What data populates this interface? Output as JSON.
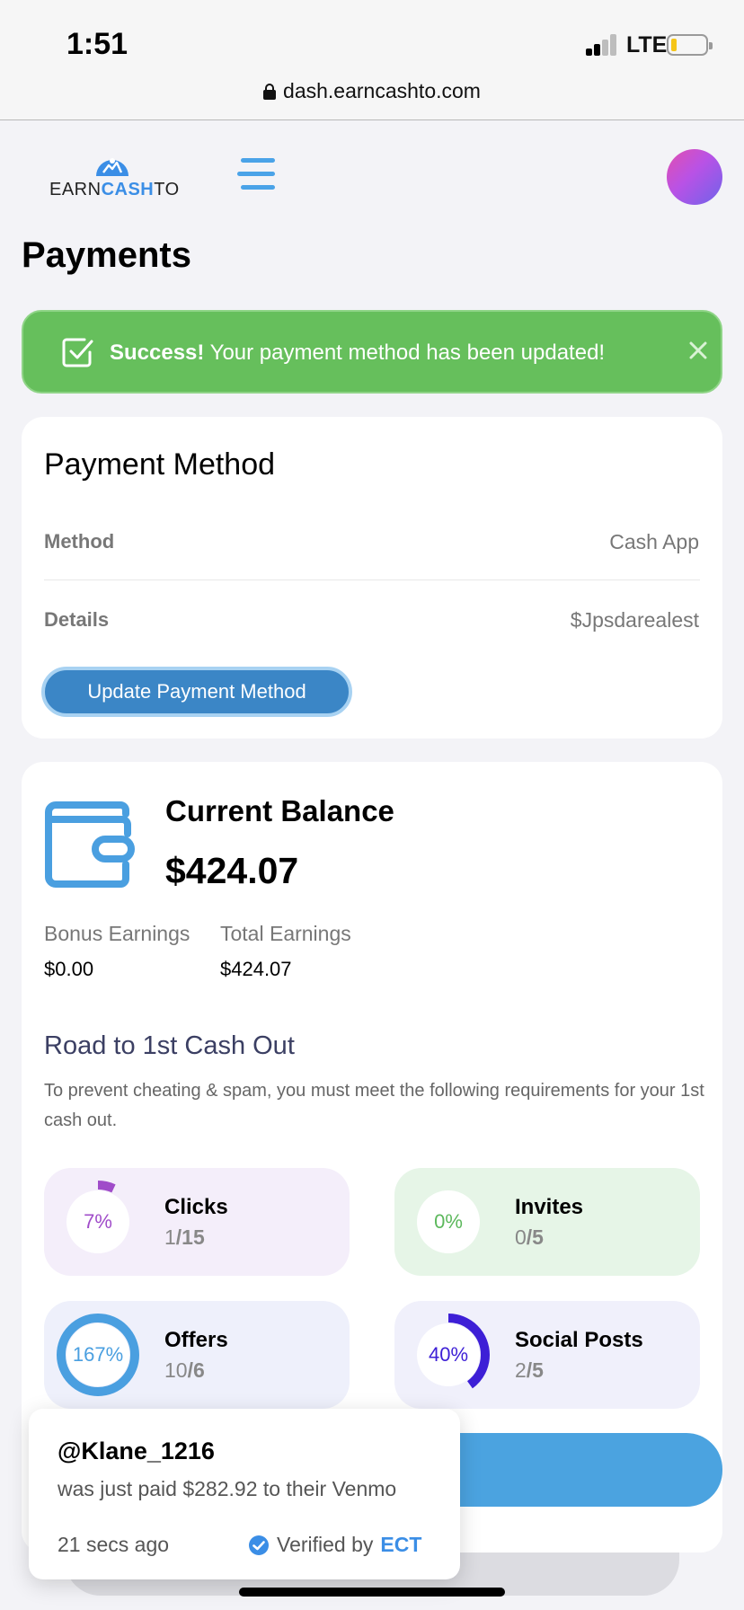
{
  "status_bar": {
    "time": "1:51",
    "network": "LTE"
  },
  "browser": {
    "url": "dash.earncashto.com"
  },
  "logo": {
    "earn": "EARN",
    "cash": "CASH",
    "to": "TO"
  },
  "page": {
    "title": "Payments"
  },
  "alert": {
    "strong": "Success!",
    "message": "Your payment method has been updated!"
  },
  "payment_method": {
    "title": "Payment Method",
    "method_label": "Method",
    "method_value": "Cash App",
    "details_label": "Details",
    "details_value": "$Jpsdarealest",
    "update_button": "Update Payment Method"
  },
  "balance": {
    "title": "Current Balance",
    "amount": "$424.07",
    "bonus_label": "Bonus Earnings",
    "bonus_value": "$0.00",
    "total_label": "Total Earnings",
    "total_value": "$424.07"
  },
  "road": {
    "title": "Road to 1st Cash Out",
    "description": "To prevent cheating & spam, you must meet the following requirements for your 1st cash out.",
    "requirements": [
      {
        "name": "Clicks",
        "current": "1",
        "target": "/15",
        "percent_label": "7%",
        "progress": 0.07,
        "color": "#a04cc9",
        "bg": "#f4eefa"
      },
      {
        "name": "Invites",
        "current": "0",
        "target": "/5",
        "percent_label": "0%",
        "progress": 0.0,
        "color": "#5cb85c",
        "bg": "#e6f5e7"
      },
      {
        "name": "Offers",
        "current": "10",
        "target": "/6",
        "percent_label": "167%",
        "progress": 1.0,
        "color": "#4a9fe0",
        "bg": "#eef0fb"
      },
      {
        "name": "Social Posts",
        "current": "2",
        "target": "/5",
        "percent_label": "40%",
        "progress": 0.4,
        "color": "#3d1fd6",
        "bg": "#f0f0fb"
      }
    ]
  },
  "toast": {
    "user": "@Klane_1216",
    "message": "was just paid $282.92 to their Venmo",
    "time": "21 secs ago",
    "verified_label": "Verified by",
    "verified_brand": "ECT"
  },
  "colors": {
    "accent": "#4ba3e0",
    "success": "#66bf5c",
    "logo_blue": "#3b8ee6"
  }
}
